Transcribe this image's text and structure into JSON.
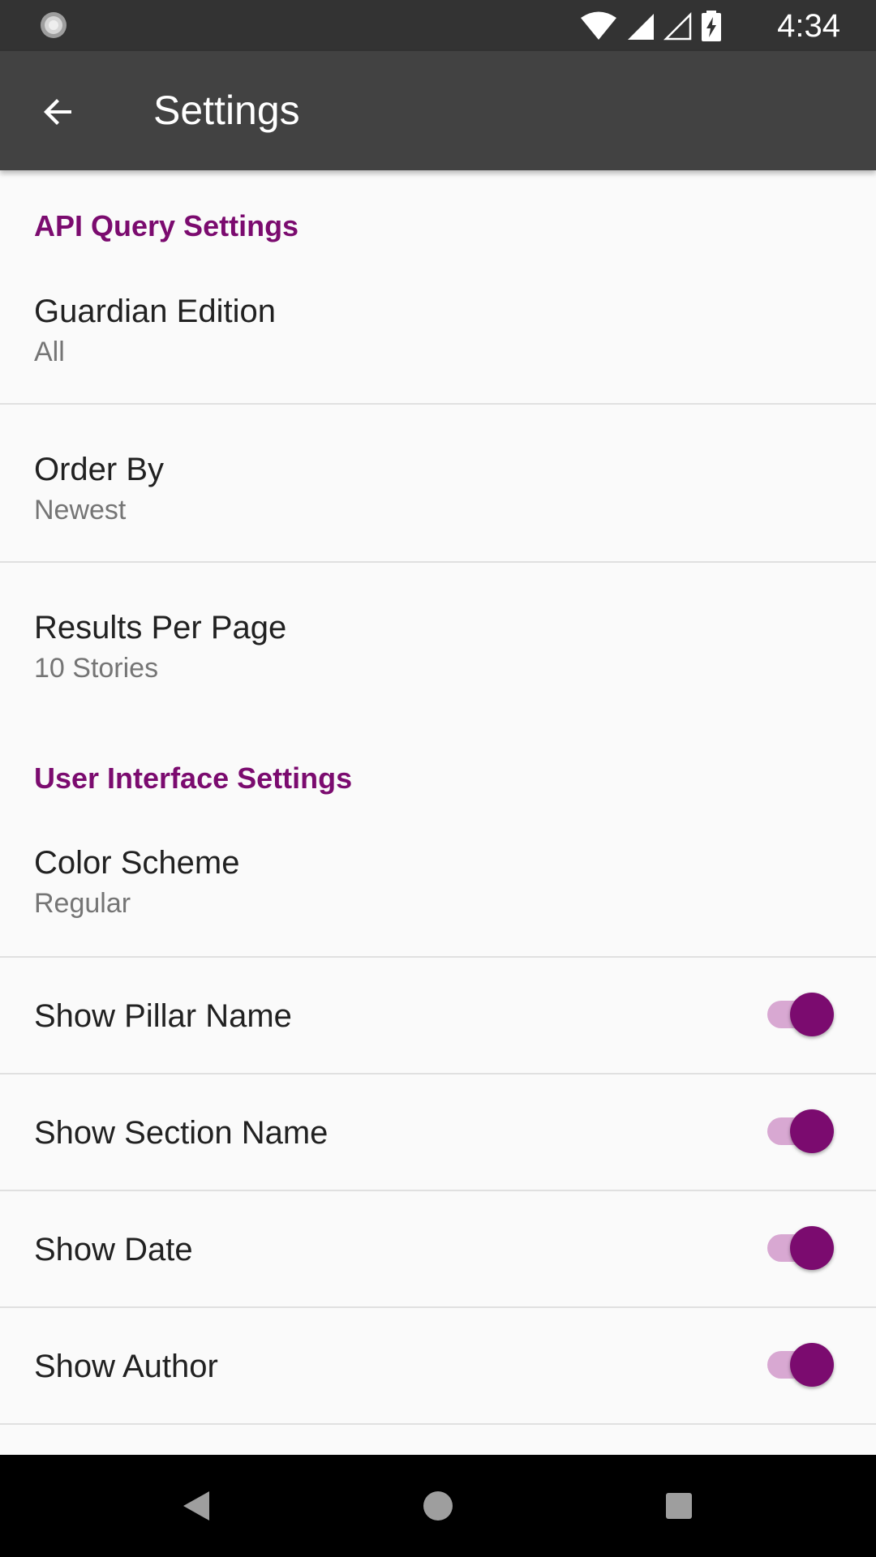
{
  "status_bar": {
    "time": "4:34",
    "icons": [
      "loading-icon",
      "wifi-icon",
      "signal-icon",
      "signal-empty-icon",
      "battery-charging-icon"
    ]
  },
  "app_bar": {
    "title": "Settings",
    "back_icon": "back-arrow-icon"
  },
  "sections": [
    {
      "header": "API Query Settings",
      "items": [
        {
          "title": "Guardian Edition",
          "summary": "All"
        },
        {
          "title": "Order By",
          "summary": "Newest"
        },
        {
          "title": "Results Per Page",
          "summary": "10 Stories"
        }
      ]
    },
    {
      "header": "User Interface Settings",
      "items": [
        {
          "title": "Color Scheme",
          "summary": "Regular"
        },
        {
          "title": "Show Pillar Name",
          "switch_on": true
        },
        {
          "title": "Show Section Name",
          "switch_on": true
        },
        {
          "title": "Show Date",
          "switch_on": true
        },
        {
          "title": "Show Author",
          "switch_on": true
        }
      ]
    }
  ],
  "nav_bar": {
    "icons": [
      "nav-back-icon",
      "nav-home-icon",
      "nav-recents-icon"
    ]
  },
  "colors": {
    "accent": "#7b0b6f",
    "status_bar": "#333333",
    "app_bar": "#424242",
    "background": "#fafafa"
  }
}
